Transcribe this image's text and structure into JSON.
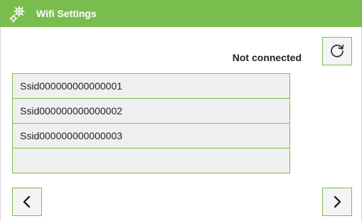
{
  "header": {
    "title": "Wifi Settings",
    "icon": "gears-icon",
    "bg_color": "#79bd4f"
  },
  "status": {
    "text": "Not connected"
  },
  "refresh": {
    "icon": "refresh-icon"
  },
  "networks": [
    {
      "ssid": "Ssid000000000000001"
    },
    {
      "ssid": "Ssid000000000000002"
    },
    {
      "ssid": "Ssid000000000000003"
    },
    {
      "ssid": ""
    }
  ],
  "navigation": {
    "prev_icon": "chevron-left-icon",
    "next_icon": "chevron-right-icon"
  },
  "colors": {
    "accent": "#79bd4f",
    "row_bg": "#efefef"
  }
}
